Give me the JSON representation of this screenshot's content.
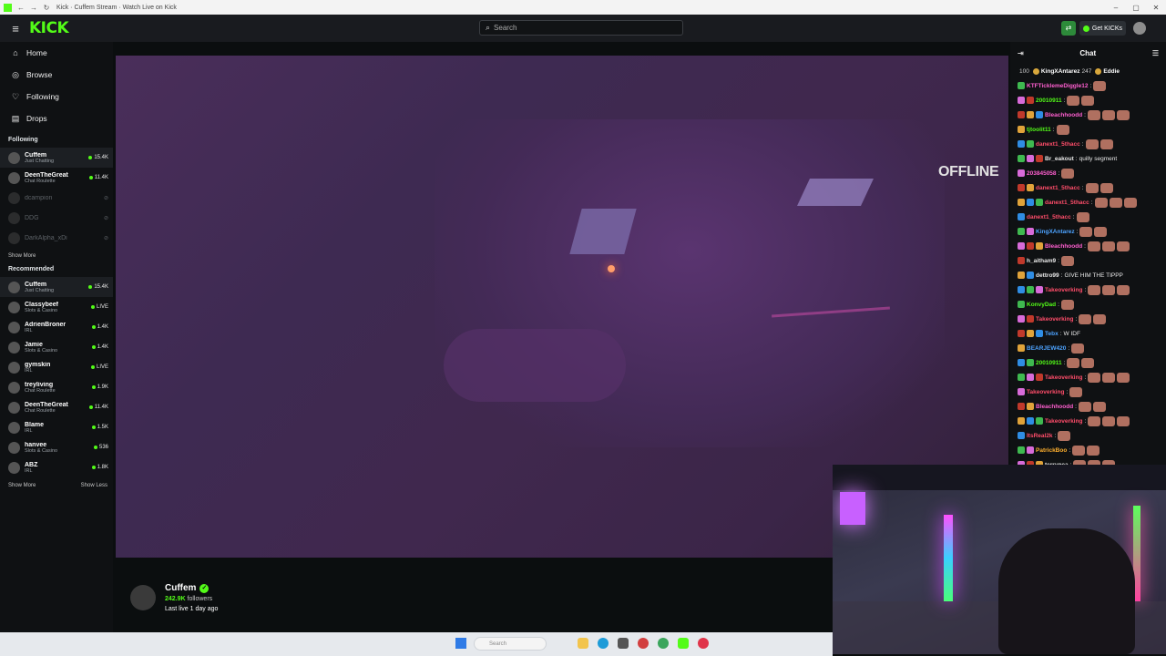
{
  "browser": {
    "tab_title": "Kick · Cuffem Stream · Watch Live on Kick"
  },
  "topnav": {
    "logo": "KICK",
    "search_placeholder": "Search",
    "get_kicks_label": "Get KICKs"
  },
  "sidebar": {
    "nav": [
      {
        "label": "Home",
        "icon": "home-icon"
      },
      {
        "label": "Browse",
        "icon": "compass-icon"
      },
      {
        "label": "Following",
        "icon": "heart-icon"
      },
      {
        "label": "Drops",
        "icon": "drops-icon"
      }
    ],
    "following_title": "Following",
    "following": [
      {
        "name": "Cuffem",
        "category": "Just Chatting",
        "viewers": "15.4K",
        "live": true
      },
      {
        "name": "DeenTheGreat",
        "category": "Chat Roulette",
        "viewers": "11.4K",
        "live": true
      },
      {
        "name": "dcampion",
        "category": "",
        "viewers": "",
        "live": false
      },
      {
        "name": "DDG",
        "category": "",
        "viewers": "",
        "live": false
      },
      {
        "name": "DarkAlpha_xDi",
        "category": "",
        "viewers": "",
        "live": false
      }
    ],
    "show_more": "Show More",
    "recommended_title": "Recommended",
    "recommended": [
      {
        "name": "Cuffem",
        "category": "Just Chatting",
        "viewers": "15.4K"
      },
      {
        "name": "Classybeef",
        "category": "Slots & Casino",
        "viewers": "LIVE"
      },
      {
        "name": "AdrienBroner",
        "category": "IRL",
        "viewers": "1.4K"
      },
      {
        "name": "Jamie",
        "category": "Slots & Casino",
        "viewers": "1.4K"
      },
      {
        "name": "gymskin",
        "category": "IRL",
        "viewers": "LIVE"
      },
      {
        "name": "treyliving",
        "category": "Chat Roulette",
        "viewers": "1.9K"
      },
      {
        "name": "DeenTheGreat",
        "category": "Chat Roulette",
        "viewers": "11.4K"
      },
      {
        "name": "Blame",
        "category": "IRL",
        "viewers": "1.5K"
      },
      {
        "name": "hanvee",
        "category": "Slots & Casino",
        "viewers": "536"
      },
      {
        "name": "ABZ",
        "category": "IRL",
        "viewers": "1.8K"
      }
    ],
    "show_less": "Show Less"
  },
  "player": {
    "status": "OFFLINE"
  },
  "streamer": {
    "name": "Cuffem",
    "followers_count": "242.9K",
    "followers_label": "followers",
    "last_live": "Last live 1 day ago"
  },
  "chat": {
    "title": "Chat",
    "gifters": [
      {
        "name": "",
        "count": "100"
      },
      {
        "name": "KingXAntarez",
        "count": "247"
      },
      {
        "name": "Eddie",
        "count": ""
      }
    ],
    "messages": [
      {
        "user": "KTFTicklemeDiggle12",
        "text": "",
        "color": "#ff5fd0"
      },
      {
        "user": "20010911",
        "text": "",
        "color": "#53fc18"
      },
      {
        "user": "Bleachhoodd",
        "text": "",
        "color": "#ff5fd0"
      },
      {
        "user": "tjtoolit11",
        "text": "",
        "color": "#53fc18"
      },
      {
        "user": "danext1_5thacc",
        "text": "",
        "color": "#ff4d6a"
      },
      {
        "user": "Br_eakout",
        "text": "quilly segment",
        "color": "#e8e8e8"
      },
      {
        "user": "203845058",
        "text": "",
        "color": "#ff5fd0"
      },
      {
        "user": "danext1_5thacc",
        "text": "",
        "color": "#ff4d6a"
      },
      {
        "user": "danext1_5thacc",
        "text": "",
        "color": "#ff4d6a"
      },
      {
        "user": "danext1_5thacc",
        "text": "",
        "color": "#ff4d6a"
      },
      {
        "user": "KingXAntarez",
        "text": "",
        "color": "#4da3ff"
      },
      {
        "user": "Bleachhoodd",
        "text": "",
        "color": "#ff5fd0"
      },
      {
        "user": "h_aitham9",
        "text": "",
        "color": "#e8e8e8"
      },
      {
        "user": "dettro99",
        "text": "GIVE HIM THE TIPPP",
        "color": "#e8e8e8"
      },
      {
        "user": "Takeoverking",
        "text": "",
        "color": "#ff4d6a"
      },
      {
        "user": "KonvyDad",
        "text": "",
        "color": "#53fc18"
      },
      {
        "user": "Takeoverking",
        "text": "",
        "color": "#ff4d6a"
      },
      {
        "user": "Tebx",
        "text": "W IDF",
        "color": "#4da3ff"
      },
      {
        "user": "BEARJEW420",
        "text": "",
        "color": "#4da3ff"
      },
      {
        "user": "20010911",
        "text": "",
        "color": "#53fc18"
      },
      {
        "user": "Takeoverking",
        "text": "",
        "color": "#ff4d6a"
      },
      {
        "user": "Takeoverking",
        "text": "",
        "color": "#ff4d6a"
      },
      {
        "user": "Bleachhoodd",
        "text": "",
        "color": "#ff5fd0"
      },
      {
        "user": "Takeoverking",
        "text": "",
        "color": "#ff4d6a"
      },
      {
        "user": "ItsReal2k",
        "text": "",
        "color": "#ff4d6a"
      },
      {
        "user": "PatrickBoo",
        "text": "",
        "color": "#ffb02e"
      },
      {
        "user": "terrynea",
        "text": "",
        "color": "#e8e8e8"
      }
    ]
  },
  "taskbar": {
    "search_placeholder": "Search"
  },
  "colors": {
    "accent": "#53fc18"
  }
}
